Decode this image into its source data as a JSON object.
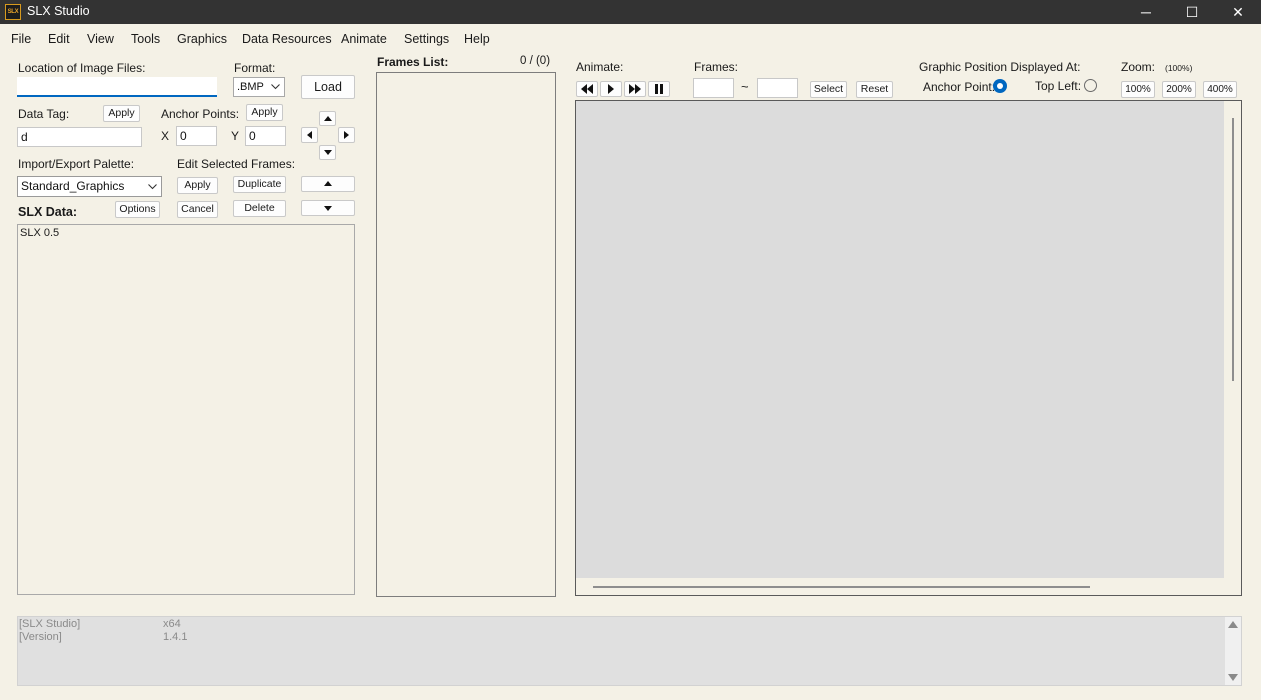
{
  "window": {
    "logo_text": "SLX",
    "title": "SLX Studio",
    "controls": {
      "minimize": "─",
      "maximize": "☐",
      "close": "✕"
    }
  },
  "menu": [
    "File",
    "Edit",
    "View",
    "Tools",
    "Graphics",
    "Data Resources",
    "Animate",
    "Settings",
    "Help"
  ],
  "left": {
    "location_label": "Location of Image Files:",
    "location_value": "",
    "format_label": "Format:",
    "format_value": ".BMP",
    "load_label": "Load",
    "data_tag_label": "Data Tag:",
    "data_tag_apply": "Apply",
    "data_tag_value": "d",
    "anchor_label": "Anchor Points:",
    "anchor_apply": "Apply",
    "x_label": "X",
    "x_value": "0",
    "y_label": "Y",
    "y_value": "0",
    "palette_label": "Import/Export Palette:",
    "palette_value": "Standard_Graphics",
    "edit_frames_label": "Edit Selected Frames:",
    "edit_apply": "Apply",
    "edit_duplicate": "Duplicate",
    "edit_cancel": "Cancel",
    "edit_delete": "Delete",
    "slx_data_label": "SLX Data:",
    "options_label": "Options",
    "slx_data_text": "SLX 0.5"
  },
  "frames": {
    "label": "Frames List:",
    "count": "0 / (0)"
  },
  "animate": {
    "label": "Animate:",
    "frames_label": "Frames:",
    "frame_from": "",
    "tilde": "~",
    "frame_to": "",
    "select_label": "Select",
    "reset_label": "Reset"
  },
  "position": {
    "label": "Graphic Position Displayed At:",
    "anchor_point_label": "Anchor Point:",
    "top_left_label": "Top Left:",
    "selected": "anchor_point"
  },
  "zoom": {
    "label": "Zoom:",
    "current": "(100%)",
    "options": [
      "100%",
      "200%",
      "400%"
    ]
  },
  "console": {
    "lines": [
      {
        "key": "[SLX Studio]",
        "value": "x64"
      },
      {
        "key": "[Version]",
        "value": "1.4.1"
      }
    ]
  },
  "colors": {
    "titlebar": "#333333",
    "background": "#f4f1e6",
    "canvas": "#dcdcdc",
    "radio_accent": "#0067c0"
  }
}
